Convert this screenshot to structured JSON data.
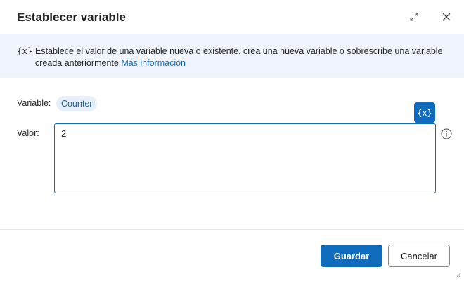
{
  "dialog": {
    "title": "Establecer variable",
    "icons": {
      "expand": "expand-icon",
      "close": "close-icon",
      "info": "info-icon",
      "variable": "variable-icon",
      "resize": "resize-grip-icon"
    }
  },
  "banner": {
    "icon_text": "{x}",
    "description": "Establece el valor de una variable nueva o existente, crea una nueva variable o sobrescribe una variable creada anteriormente",
    "link_label": "Más información"
  },
  "form": {
    "variable_label": "Variable:",
    "variable_name": "Counter",
    "value_label": "Valor:",
    "value": "2",
    "insert_variable_button": "{x}"
  },
  "footer": {
    "save_label": "Guardar",
    "cancel_label": "Cancelar"
  },
  "colors": {
    "accent": "#0f6cbd",
    "banner_bg": "#eff4fc",
    "chip_bg": "#e6f0fa"
  }
}
